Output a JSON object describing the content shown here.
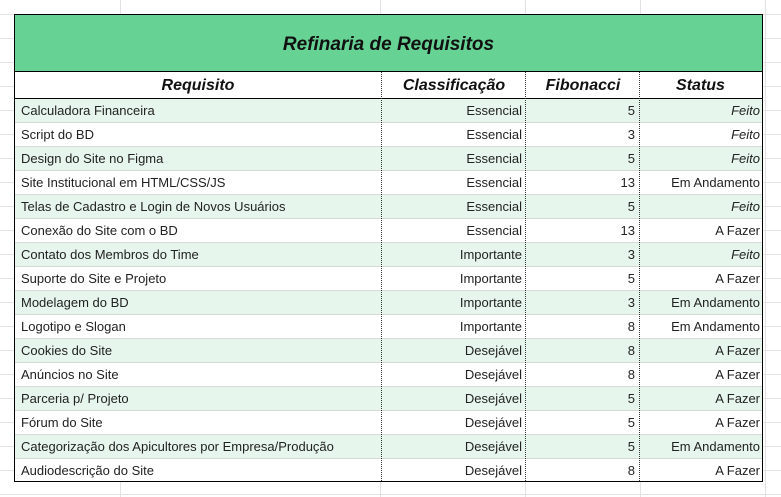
{
  "table": {
    "title": "Refinaria de Requisitos",
    "headers": {
      "requisito": "Requisito",
      "classificacao": "Classificação",
      "fibonacci": "Fibonacci",
      "status": "Status"
    },
    "rows": [
      {
        "requisito": "Calculadora Financeira",
        "classificacao": "Essencial",
        "fibonacci": "5",
        "status": "Feito"
      },
      {
        "requisito": "Script do BD",
        "classificacao": "Essencial",
        "fibonacci": "3",
        "status": "Feito"
      },
      {
        "requisito": "Design do Site no Figma",
        "classificacao": "Essencial",
        "fibonacci": "5",
        "status": "Feito"
      },
      {
        "requisito": "Site Institucional em HTML/CSS/JS",
        "classificacao": "Essencial",
        "fibonacci": "13",
        "status": "Em Andamento"
      },
      {
        "requisito": "Telas de Cadastro e Login de Novos Usuários",
        "classificacao": "Essencial",
        "fibonacci": "5",
        "status": "Feito"
      },
      {
        "requisito": "Conexão do Site com o BD",
        "classificacao": "Essencial",
        "fibonacci": "13",
        "status": "A Fazer"
      },
      {
        "requisito": "Contato dos Membros do Time",
        "classificacao": "Importante",
        "fibonacci": "3",
        "status": "Feito"
      },
      {
        "requisito": "Suporte do Site e Projeto",
        "classificacao": "Importante",
        "fibonacci": "5",
        "status": "A Fazer"
      },
      {
        "requisito": "Modelagem do BD",
        "classificacao": "Importante",
        "fibonacci": "3",
        "status": "Em Andamento"
      },
      {
        "requisito": "Logotipo e Slogan",
        "classificacao": "Importante",
        "fibonacci": "8",
        "status": "Em Andamento"
      },
      {
        "requisito": "Cookies do Site",
        "classificacao": "Desejável",
        "fibonacci": "8",
        "status": "A Fazer"
      },
      {
        "requisito": "Anúncios no Site",
        "classificacao": "Desejável",
        "fibonacci": "8",
        "status": "A Fazer"
      },
      {
        "requisito": "Parceria p/ Projeto",
        "classificacao": "Desejável",
        "fibonacci": "5",
        "status": "A Fazer"
      },
      {
        "requisito": "Fórum do Site",
        "classificacao": "Desejável",
        "fibonacci": "5",
        "status": "A Fazer"
      },
      {
        "requisito": "Categorização dos Apicultores por Empresa/Produção",
        "classificacao": "Desejável",
        "fibonacci": "5",
        "status": "Em Andamento"
      },
      {
        "requisito": "Audiodescrição do Site",
        "classificacao": "Desejável",
        "fibonacci": "8",
        "status": "A Fazer"
      }
    ]
  },
  "colors": {
    "title_fill": "#66d394",
    "alt_row_fill": "#e7f6ec",
    "gridline": "#e2e2e2"
  }
}
